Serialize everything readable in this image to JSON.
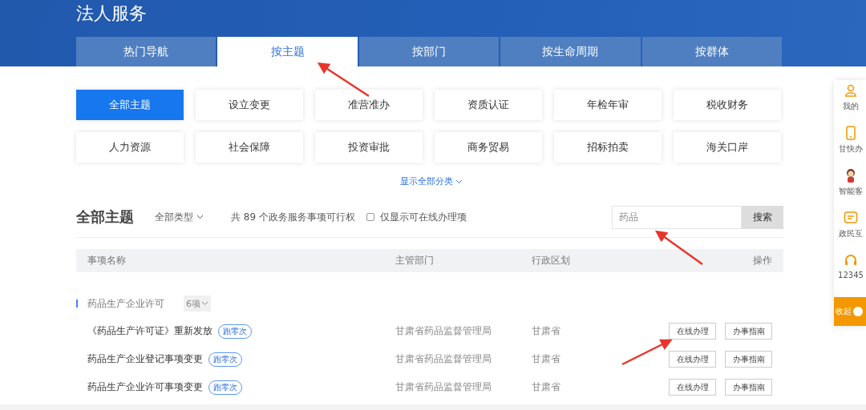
{
  "header": {
    "title": "法人服务"
  },
  "tabs": [
    {
      "label": "热门导航",
      "selected": false
    },
    {
      "label": "按主题",
      "selected": true
    },
    {
      "label": "按部门",
      "selected": false
    },
    {
      "label": "按生命周期",
      "selected": false
    },
    {
      "label": "按群体",
      "selected": false
    }
  ],
  "categories": [
    {
      "label": "全部主题",
      "selected": true
    },
    {
      "label": "设立变更",
      "selected": false
    },
    {
      "label": "准营准办",
      "selected": false
    },
    {
      "label": "资质认证",
      "selected": false
    },
    {
      "label": "年检年审",
      "selected": false
    },
    {
      "label": "税收财务",
      "selected": false
    },
    {
      "label": "人力资源",
      "selected": false
    },
    {
      "label": "社会保障",
      "selected": false
    },
    {
      "label": "投资审批",
      "selected": false
    },
    {
      "label": "商务贸易",
      "selected": false
    },
    {
      "label": "招标拍卖",
      "selected": false
    },
    {
      "label": "海关口岸",
      "selected": false
    }
  ],
  "show_all_link": "显示全部分类",
  "toolbar": {
    "title": "全部主题",
    "type_filter": "全部类型",
    "count_text": "共 89 个政务服务事项可行权",
    "online_only": {
      "label": "仅显示可在线办理项",
      "checked": false
    },
    "search": {
      "value": "药品",
      "button": "搜索"
    }
  },
  "table": {
    "columns": [
      "事项名称",
      "主管部门",
      "行政区划",
      "操作"
    ],
    "groups": [
      {
        "name": "药品生产企业许可",
        "count": "6项",
        "rows": [
          {
            "name": "《药品生产许可证》重新发放",
            "tag": "跑零次",
            "department": "甘肃省药品监督管理局",
            "region": "甘肃省",
            "actions": [
              "在线办理",
              "办事指南"
            ]
          },
          {
            "name": "药品生产企业登记事项变更",
            "tag": "跑零次",
            "department": "甘肃省药品监督管理局",
            "region": "甘肃省",
            "actions": [
              "在线办理",
              "办事指南"
            ]
          },
          {
            "name": "药品生产企业许可事项变更",
            "tag": "跑零次",
            "department": "甘肃省药品监督管理局",
            "region": "甘肃省",
            "actions": [
              "在线办理",
              "办事指南"
            ]
          }
        ]
      }
    ]
  },
  "side_panel": {
    "items": [
      {
        "kind": "person",
        "label": "我的"
      },
      {
        "kind": "phone",
        "label": "甘快办"
      },
      {
        "kind": "mascot",
        "label": "智能客"
      },
      {
        "kind": "chat",
        "label": "政民互"
      },
      {
        "kind": "headset",
        "label": "12345"
      }
    ],
    "collapse": "收起"
  }
}
